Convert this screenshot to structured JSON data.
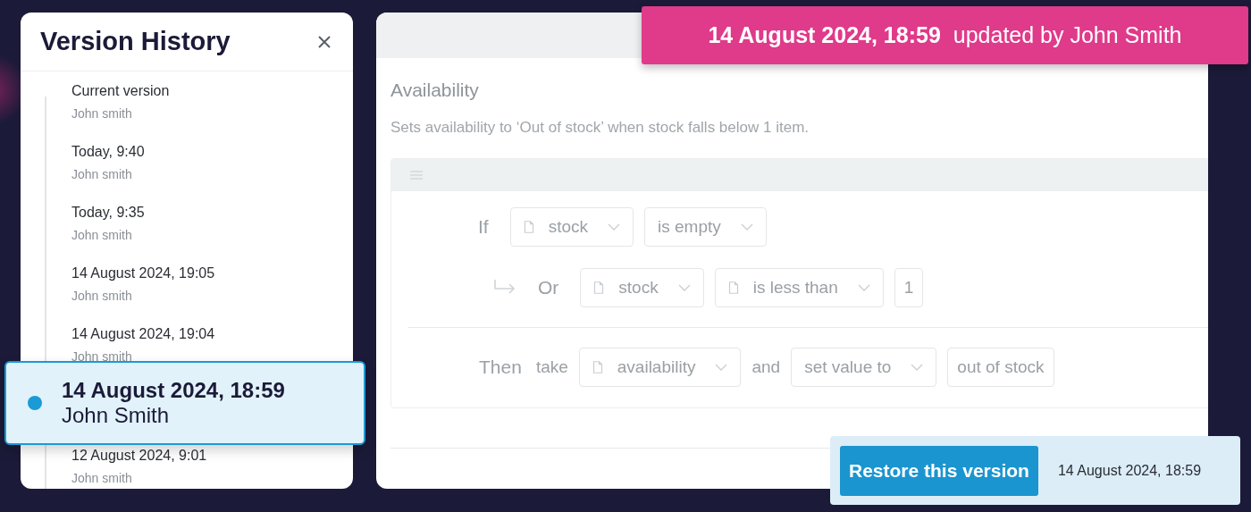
{
  "version_history": {
    "title": "Version History",
    "items": [
      {
        "label": "Current version",
        "author": "John smith",
        "selected": false
      },
      {
        "label": "Today, 9:40",
        "author": "John smith",
        "selected": false
      },
      {
        "label": "Today, 9:35",
        "author": "John smith",
        "selected": false
      },
      {
        "label": "14 August 2024, 19:05",
        "author": "John smith",
        "selected": false
      },
      {
        "label": "14 August 2024, 19:04",
        "author": "John smith",
        "selected": false
      },
      {
        "label": "14 August 2024, 18:59",
        "author": "John Smith",
        "selected": true
      },
      {
        "label": "12 August 2024, 9:01",
        "author": "John smith",
        "selected": false
      }
    ]
  },
  "update_banner": {
    "date": "14 August 2024, 18:59",
    "text": "updated by John Smith"
  },
  "rule": {
    "title": "Availability",
    "description": "Sets availability to ‘Out of stock’ when stock falls below 1 item.",
    "conditions": [
      {
        "kind": "if",
        "keyword": "If",
        "parts": [
          {
            "kind": "dropdown",
            "text": "stock",
            "icon": true
          },
          {
            "kind": "dropdown",
            "text": "is empty",
            "icon": false
          }
        ]
      },
      {
        "kind": "or",
        "keyword": "Or",
        "parts": [
          {
            "kind": "dropdown",
            "text": "stock",
            "icon": true
          },
          {
            "kind": "dropdown",
            "text": "is less than",
            "icon": true
          },
          {
            "kind": "input",
            "text": "1"
          }
        ]
      }
    ],
    "action": {
      "keyword": "Then",
      "parts": [
        {
          "kind": "word",
          "text": "take"
        },
        {
          "kind": "dropdown",
          "text": "availability",
          "icon": true
        },
        {
          "kind": "word",
          "text": "and"
        },
        {
          "kind": "dropdown",
          "text": "set value to",
          "icon": false
        },
        {
          "kind": "input",
          "text": "out of stock"
        }
      ]
    }
  },
  "restore": {
    "button": "Restore this version",
    "date": "14 August 2024, 18:59"
  }
}
